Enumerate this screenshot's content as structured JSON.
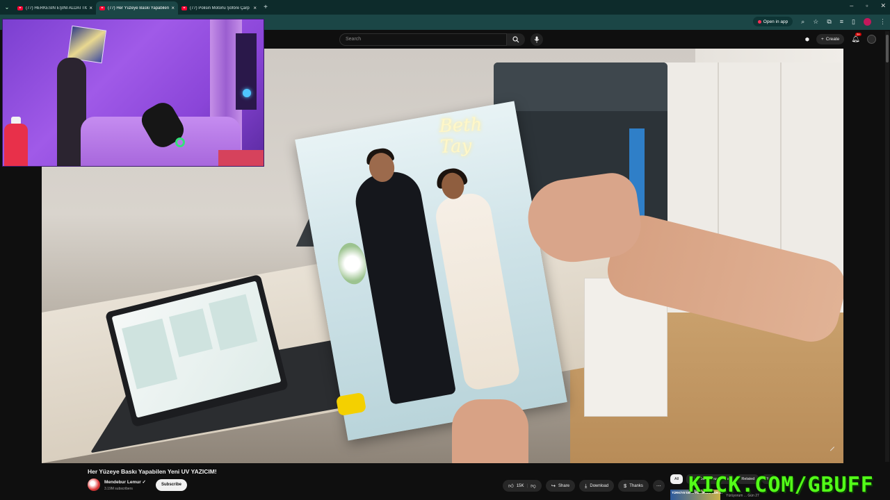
{
  "browser": {
    "tabs": [
      {
        "title": "(77) HERKESİN EŞİNİ ALDATTIĞI"
      },
      {
        "title": "(77) Her Yüzeye Baskı Yapabilen"
      },
      {
        "title": "(77) Polisin Motorlu Şöföre Çarp"
      }
    ],
    "open_in_app": "Open in app"
  },
  "youtube": {
    "search_placeholder": "Search",
    "create_label": "Create",
    "notif_badge": "9+"
  },
  "video": {
    "photo_neon_text": "Beth Tay"
  },
  "info": {
    "title": "Her Yüzeye Baskı Yapabilen Yeni UV YAZICIM!",
    "channel": "Mendebur Lemur",
    "subscribers": "3.19M subscribers",
    "subscribe": "Subscribe",
    "likes": "15K",
    "share": "Share",
    "download": "Download",
    "thanks": "Thanks",
    "chips": [
      "All",
      "From Mendebur Lemur",
      "Related",
      "Fo"
    ],
    "rec_thumb_text": "TÜRKİYE'DE ... TÜYORUM GÜN 27",
    "rec_meta": "Yürüyorum ... Gün 27"
  },
  "overlay": {
    "kick_text": "KICK.COM/GBUFF"
  },
  "colors": {
    "kick_green": "#53fc18",
    "yt_red": "#ff0033",
    "cam_purple": "#8a45d8",
    "tab_bg": "#0d2b2b"
  }
}
